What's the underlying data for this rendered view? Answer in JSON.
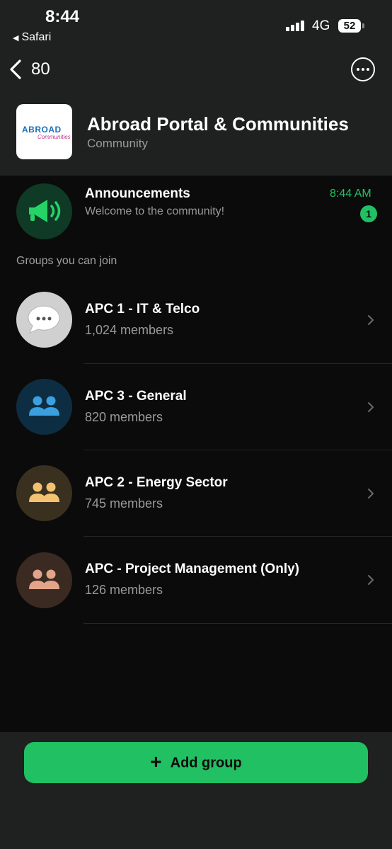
{
  "status_bar": {
    "time": "8:44",
    "back_app": "Safari",
    "network": "4G",
    "battery": "52"
  },
  "nav": {
    "back_count": "80",
    "more_icon": "more-options-icon"
  },
  "community": {
    "name": "Abroad Portal & Communities",
    "type": "Community",
    "logo_text": "ABROAD",
    "logo_subtext": "Communities"
  },
  "announcements": {
    "title": "Announcements",
    "preview": "Welcome to the community!",
    "time": "8:44 AM",
    "unread": "1",
    "icon": "megaphone-icon"
  },
  "section_label": "Groups you can join",
  "groups": [
    {
      "name": "APC 1 - IT & Telco",
      "members": "1,024 members",
      "icon": "chat-bubble-icon",
      "color": "#d6d6d6"
    },
    {
      "name": "APC 3 - General",
      "members": "820 members",
      "icon": "group-icon",
      "color": "#3aa0e0"
    },
    {
      "name": "APC 2 - Energy Sector",
      "members": "745 members",
      "icon": "group-icon",
      "color": "#f2c272"
    },
    {
      "name": "APC - Project Management (Only)",
      "members": "126 members",
      "icon": "group-icon",
      "color": "#e3a58a"
    }
  ],
  "footer": {
    "add_group_label": "Add group"
  },
  "colors": {
    "accent": "#21c063",
    "background": "#0b0b0b",
    "header": "#1f2020"
  }
}
